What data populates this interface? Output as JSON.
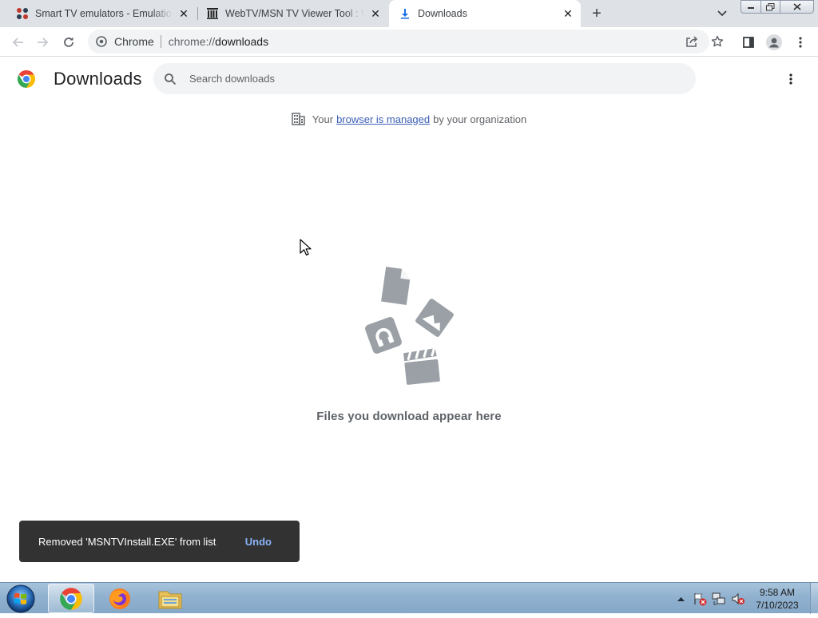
{
  "tabs": [
    {
      "title": "Smart TV emulators - Emulation General Wiki",
      "icon": "emulation-wiki-favicon",
      "active": false
    },
    {
      "title": "WebTV/MSN TV Viewer Tool : WebTV : Free Download",
      "icon": "internet-archive-favicon",
      "active": false
    },
    {
      "title": "Downloads",
      "icon": "download-icon",
      "active": true
    }
  ],
  "toolbar": {
    "site_chip": "Chrome",
    "url_scheme": "chrome://",
    "url_host": "downloads"
  },
  "page": {
    "title": "Downloads",
    "search_placeholder": "Search downloads",
    "managed": {
      "prefix": "Your",
      "link": "browser is managed",
      "suffix": "by your organization"
    },
    "empty_message": "Files you download appear here"
  },
  "toast": {
    "message": "Removed 'MSNTVInstall.EXE' from list",
    "action": "Undo"
  },
  "taskbar": {
    "apps": [
      "chrome-icon",
      "firefox-icon",
      "file-explorer-icon"
    ],
    "clock_time": "9:58 AM",
    "clock_date": "7/10/2023"
  },
  "colors": {
    "tabstrip": "#dee1e6",
    "omnibox": "#f1f3f4",
    "toast_bg": "#323232",
    "toast_action": "#8ab4f8",
    "illustration": "#9aa0a6"
  }
}
